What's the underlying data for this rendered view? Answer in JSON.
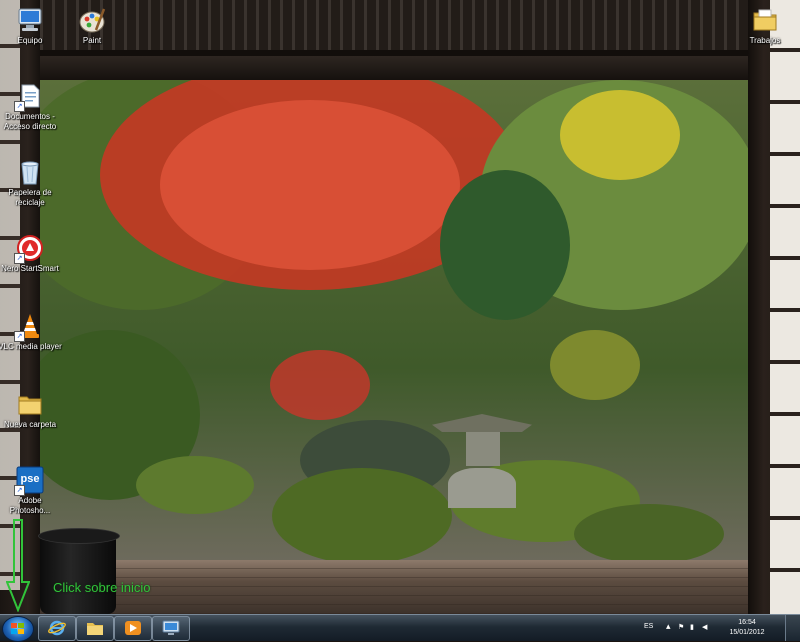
{
  "desktop_icons": [
    {
      "id": "equipo",
      "label": "Equipo"
    },
    {
      "id": "paint",
      "label": "Paint"
    },
    {
      "id": "trabajos",
      "label": "Trabajos"
    },
    {
      "id": "documentos",
      "label": "Documentos - Acceso directo"
    },
    {
      "id": "papelera",
      "label": "Papelera de reciclaje"
    },
    {
      "id": "nero",
      "label": "Nero StartSmart"
    },
    {
      "id": "vlc",
      "label": "VLC media player"
    },
    {
      "id": "nueva-carpeta",
      "label": "Nueva carpeta"
    },
    {
      "id": "photoshop",
      "label": "Adobe Photosho...",
      "badge": "pse"
    }
  ],
  "hint": {
    "text": "Click sobre inicio",
    "color": "#31c43a"
  },
  "taskbar": {
    "pinned": [
      {
        "name": "internet-explorer",
        "icon": "ie-icon"
      },
      {
        "name": "windows-explorer",
        "icon": "folder-icon"
      },
      {
        "name": "media-player",
        "icon": "play-icon"
      },
      {
        "name": "control-panel",
        "icon": "monitor-icon"
      }
    ],
    "tray": {
      "language": "ES",
      "time": "16:54",
      "date": "15/01/2012"
    }
  }
}
